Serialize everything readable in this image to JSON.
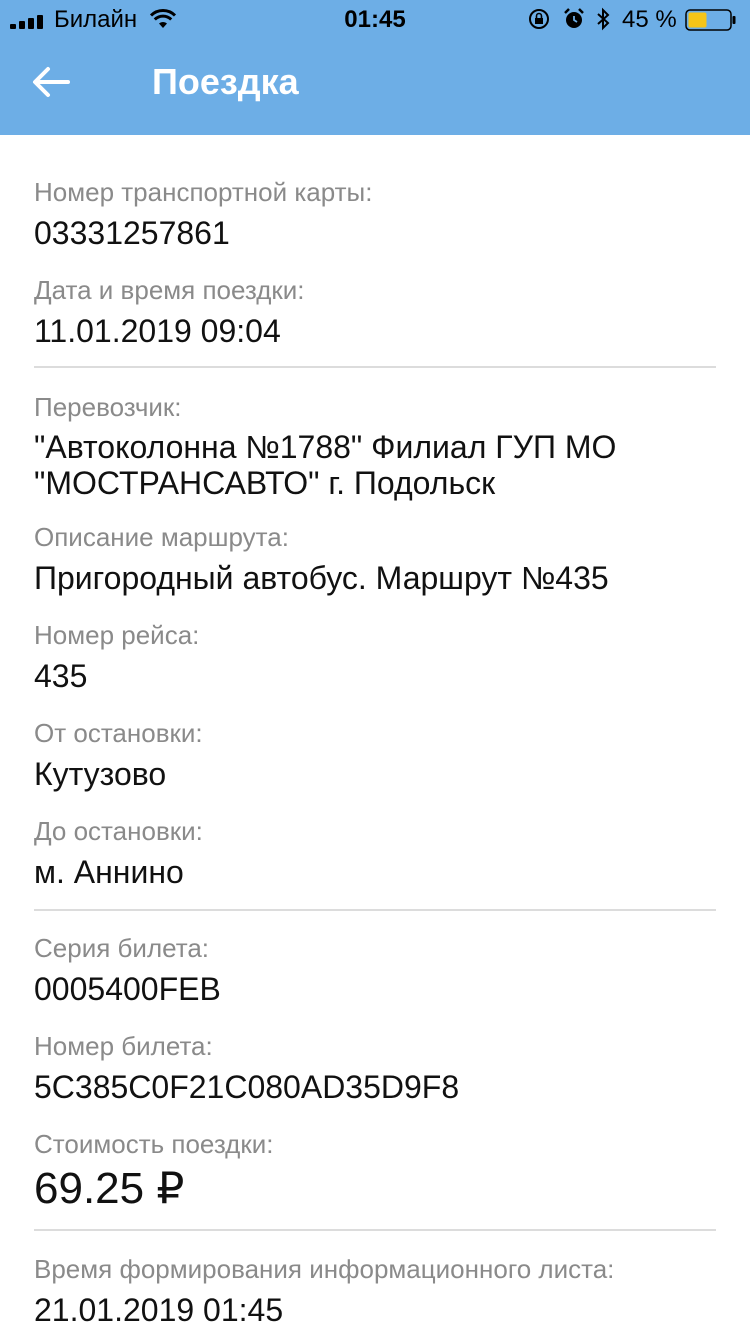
{
  "status_bar": {
    "carrier": "Билайн",
    "time": "01:45",
    "battery_percent": "45 %",
    "battery_level": 0.45,
    "battery_color": "#f5c518",
    "icons": [
      "signal-icon",
      "wifi-icon",
      "orientation-lock-icon",
      "alarm-icon",
      "bluetooth-icon",
      "battery-icon"
    ]
  },
  "header": {
    "title": "Поездка",
    "back_icon": "arrow-left-icon",
    "background_color": "#6daee6"
  },
  "trip": {
    "card_number": {
      "label": "Номер транспортной карты:",
      "value": "03331257861"
    },
    "datetime": {
      "label": "Дата и время поездки:",
      "value": "11.01.2019 09:04"
    },
    "carrier": {
      "label": "Перевозчик:",
      "value": "\"Автоколонна №1788\" Филиал ГУП МО \"МОСТРАНСАВТО\" г. Подольск"
    },
    "route": {
      "label": "Описание маршрута:",
      "value": "Пригородный автобус. Маршрут №435"
    },
    "trip_number": {
      "label": "Номер рейса:",
      "value": "435"
    },
    "from_stop": {
      "label": "От остановки:",
      "value": "Кутузово"
    },
    "to_stop": {
      "label": "До остановки:",
      "value": "м. Аннино"
    },
    "ticket_series": {
      "label": "Серия билета:",
      "value": "0005400FEB"
    },
    "ticket_number": {
      "label": "Номер билета:",
      "value": "5C385C0F21C080AD35D9F8"
    },
    "cost": {
      "label": "Стоимость поездки:",
      "value": "69.25 ₽"
    },
    "generated_at": {
      "label": "Время формирования информационного листа:",
      "value": "21.01.2019 01:45"
    }
  }
}
